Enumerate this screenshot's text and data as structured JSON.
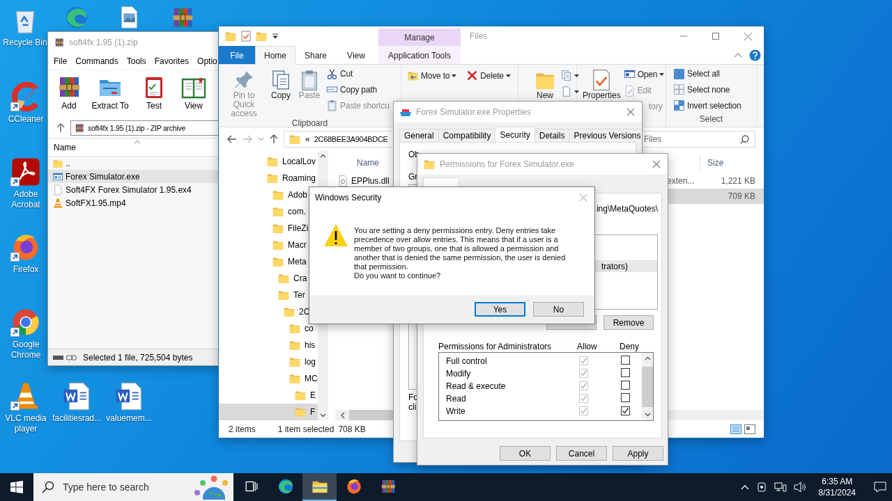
{
  "desktop_icons": [
    {
      "kind": "recycle-bin",
      "label": "Recycle Bin"
    },
    {
      "kind": "edge"
    },
    {
      "kind": "image-file"
    },
    {
      "kind": "winrar"
    },
    {
      "kind": "ccleaner",
      "label": "CCleaner"
    },
    {
      "kind": "acrobat",
      "label": "Adobe Acrobat"
    },
    {
      "kind": "firefox",
      "label": "Firefox"
    },
    {
      "kind": "chrome",
      "label": "Google Chrome"
    },
    {
      "kind": "vlc",
      "label": "VLC media player"
    },
    {
      "kind": "word",
      "label": "facilitiesrad..."
    },
    {
      "kind": "word",
      "label": "valuemem..."
    }
  ],
  "winrar": {
    "title": "soft4fx 1.95 (1).zip",
    "menu": [
      "File",
      "Commands",
      "Tools",
      "Favorites",
      "Optio"
    ],
    "tools": [
      {
        "kind": "add",
        "label": "Add"
      },
      {
        "kind": "extract",
        "label": "Extract To"
      },
      {
        "kind": "test",
        "label": "Test"
      },
      {
        "kind": "view",
        "label": "View"
      }
    ],
    "address": "soft4fx 1.95 (1).zip - ZIP archive",
    "column": "Name",
    "files": [
      {
        "kind": "folder",
        "name": "..",
        "selected": false
      },
      {
        "kind": "exe",
        "name": "Forex Simulator.exe",
        "selected": true
      },
      {
        "kind": "file",
        "name": "Soft4FX Forex Simulator 1.95.ex4",
        "selected": false
      },
      {
        "kind": "vlc",
        "name": "SoftFX1.95.mp4",
        "selected": false
      }
    ],
    "status": "Selected 1 file, 725,504 bytes"
  },
  "explorer": {
    "context_tab": "Manage",
    "title": "Files",
    "tabs": [
      {
        "kind": "file-menu",
        "label": "File",
        "selected": false
      },
      {
        "kind": "tab",
        "label": "Home",
        "selected": true
      },
      {
        "kind": "tab",
        "label": "Share",
        "selected": false
      },
      {
        "kind": "tab",
        "label": "View",
        "selected": false
      },
      {
        "kind": "context",
        "label": "Application Tools",
        "selected": false
      }
    ],
    "ribbon": [
      {
        "label": "Clipboard",
        "items": [
          {
            "kind": "large",
            "label": "Pin to Quick access",
            "disabled": true
          },
          {
            "kind": "large",
            "label": "Copy",
            "disabled": false
          },
          {
            "kind": "large",
            "label": "Paste",
            "disabled": true
          },
          {
            "kind": "stack",
            "items": [
              {
                "kind": "small",
                "label": "Cut",
                "disabled": false
              },
              {
                "kind": "small",
                "label": "Copy path",
                "disabled": false
              },
              {
                "kind": "small",
                "label": "Paste shortcu",
                "disabled": true
              }
            ]
          }
        ]
      },
      {
        "items": [
          {
            "kind": "stack",
            "items": [
              {
                "kind": "small",
                "label": "Move to",
                "disabled": false,
                "dropdown": true
              }
            ]
          },
          {
            "kind": "stack",
            "items": [
              {
                "kind": "small",
                "label": "Delete",
                "disabled": false,
                "dropdown": true
              }
            ]
          }
        ]
      },
      {
        "items": [
          {
            "kind": "large",
            "label": "New",
            "disabled": false
          },
          {
            "kind": "stack",
            "items": [
              {
                "kind": "small",
                "dropdown": true
              },
              {
                "kind": "small",
                "dropdown": true
              }
            ]
          }
        ]
      },
      {
        "items": [
          {
            "kind": "large",
            "label": "Properties",
            "disabled": false
          },
          {
            "kind": "stack",
            "items": [
              {
                "kind": "small",
                "label": "Open",
                "disabled": false,
                "dropdown": true
              },
              {
                "kind": "small",
                "label": "Edit",
                "disabled": true
              },
              {
                "kind": "fragment",
                "label": "tory",
                "disabled": true
              }
            ]
          }
        ]
      },
      {
        "label": "Select",
        "items": [
          {
            "kind": "stack",
            "items": [
              {
                "kind": "small",
                "label": "Select all",
                "disabled": false
              },
              {
                "kind": "small",
                "label": "Select none",
                "disabled": false
              },
              {
                "kind": "small",
                "label": "Invert selection",
                "disabled": false
              }
            ]
          }
        ]
      }
    ],
    "address_prefix": "«",
    "address": "2C68BEE3A904BDCE",
    "search": {
      "placeholder": "Files"
    },
    "tree": [
      {
        "name": "LocalLov",
        "selected": false
      },
      {
        "name": "Roaming",
        "selected": false,
        "children": [
          {
            "name": "Adob",
            "selected": false
          },
          {
            "name": "com.",
            "selected": false
          },
          {
            "name": "FileZi",
            "selected": false
          },
          {
            "name": "Macr",
            "selected": false
          },
          {
            "name": "Meta",
            "selected": false,
            "children": [
              {
                "name": "Cra",
                "selected": false
              },
              {
                "name": "Ter",
                "selected": false,
                "children": [
                  {
                    "name": "2C",
                    "selected": false,
                    "children": [
                      {
                        "name": "co",
                        "selected": false
                      },
                      {
                        "name": "his",
                        "selected": false
                      },
                      {
                        "name": "log",
                        "selected": false
                      },
                      {
                        "name": "MC",
                        "selected": false,
                        "children": [
                          {
                            "name": "E",
                            "selected": false
                          },
                          {
                            "name": "F",
                            "selected": true
                          }
                        ]
                      }
                    ]
                  }
                ]
              }
            ]
          }
        ]
      }
    ],
    "columns": [
      "Name",
      "Size"
    ],
    "rows": [
      {
        "name": "EPPlus.dll",
        "type": "exten...",
        "size": "1,221 KB",
        "selected": false
      },
      {
        "size": "709 KB",
        "selected": true
      }
    ],
    "status": [
      "2 items",
      "1 item selected",
      "708 KB"
    ]
  },
  "properties": {
    "title": "Forex Simulator.exe Properties",
    "tabs": [
      {
        "label": "General",
        "selected": false
      },
      {
        "label": "Compatibility",
        "selected": false
      },
      {
        "label": "Security",
        "selected": true
      },
      {
        "label": "Details",
        "selected": false
      },
      {
        "label": "Previous Versions",
        "selected": false
      }
    ],
    "object_label": "Ob",
    "group_label": "Gr",
    "footer_lines": [
      "Fo",
      "cli"
    ]
  },
  "permissions": {
    "title": "Permissions for Forex Simulator.exe",
    "object_path": "ing\\MetaQuotes\\",
    "groups": [
      {
        "name": "trators)",
        "selected": true
      }
    ],
    "remove_button": "Remove",
    "list_label": "Permissions for Administrators",
    "allow_label": "Allow",
    "deny_label": "Deny",
    "rows": [
      {
        "name": "Full control",
        "allow": {
          "checked": true,
          "disabled": true
        },
        "deny": false
      },
      {
        "name": "Modify",
        "allow": {
          "checked": true,
          "disabled": true
        },
        "deny": false
      },
      {
        "name": "Read & execute",
        "allow": {
          "checked": true,
          "disabled": true
        },
        "deny": false
      },
      {
        "name": "Read",
        "allow": {
          "checked": true,
          "disabled": true
        },
        "deny": false
      },
      {
        "name": "Write",
        "allow": {
          "checked": true,
          "disabled": true
        },
        "deny": true
      }
    ],
    "buttons": [
      "OK",
      "Cancel",
      "Apply"
    ]
  },
  "security_dialog": {
    "title": "Windows Security",
    "message": "You are setting a deny permissions entry. Deny entries take precedence over allow entries. This means that if a user is a member of two groups, one that is allowed a permission and another that is denied the same permission, the user is denied that permission.",
    "question": "Do you want to continue?",
    "buttons": [
      {
        "label": "Yes",
        "focused": true
      },
      {
        "label": "No",
        "focused": false
      }
    ]
  },
  "taskbar": {
    "search_placeholder": "Type here to search",
    "apps": [
      {
        "kind": "task-view",
        "active": false
      },
      {
        "kind": "edge",
        "active": false
      },
      {
        "kind": "explorer",
        "active": true
      },
      {
        "kind": "firefox",
        "active": false
      },
      {
        "kind": "winrar",
        "active": false
      }
    ],
    "time": "6:35 AM",
    "date": "8/31/2024"
  }
}
